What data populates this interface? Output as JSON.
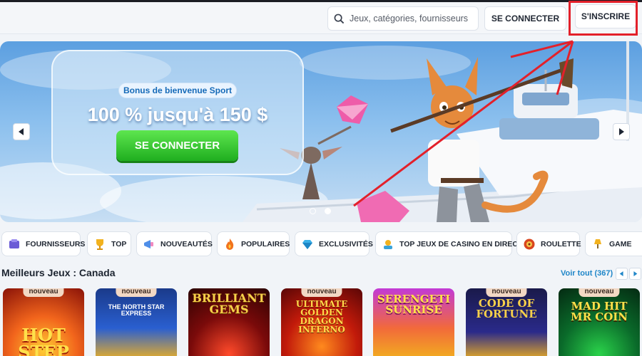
{
  "header": {
    "search_placeholder": "Jeux, catégories, fournisseurs",
    "login_label": "SE CONNECTER",
    "signup_label": "S'INSCRIRE"
  },
  "banner": {
    "badge": "Bonus de bienvenue Sport",
    "headline": "100 % jusqu'à 150 $",
    "cta_label": "SE CONNECTER",
    "slides": 2,
    "active_slide": 2
  },
  "categories": [
    {
      "label": "FOURNISSEURS",
      "icon": "providers-icon"
    },
    {
      "label": "TOP",
      "icon": "trophy-icon"
    },
    {
      "label": "NOUVEAUTÉS",
      "icon": "megaphone-icon"
    },
    {
      "label": "POPULAIRES",
      "icon": "fire-icon"
    },
    {
      "label": "EXCLUSIVITÉS",
      "icon": "diamond-icon"
    },
    {
      "label": "TOP JEUX DE CASINO EN DIRECT",
      "icon": "live-dealer-icon"
    },
    {
      "label": "ROULETTE",
      "icon": "roulette-icon"
    },
    {
      "label": "GAME",
      "icon": "lamp-icon"
    }
  ],
  "section": {
    "title": "Meilleurs Jeux : Canada",
    "see_all": "Voir tout (367)"
  },
  "games": [
    {
      "title": "HOT STEP",
      "badge": "nouveau"
    },
    {
      "title": "THE NORTH STAR EXPRESS",
      "badge": "nouveau"
    },
    {
      "title": "BRILLIANT GEMS",
      "badge": ""
    },
    {
      "title": "ULTIMATE GOLDEN DRAGON INFERNO",
      "badge": "nouveau"
    },
    {
      "title": "SERENGETI SUNRISE",
      "badge": ""
    },
    {
      "title": "CODE OF FORTUNE",
      "badge": "nouveau"
    },
    {
      "title": "MAD HIT MR COIN",
      "badge": "nouveau"
    }
  ],
  "colors": {
    "accent_blue": "#1f86c8",
    "cta_green": "#2fc12a",
    "annotation_red": "#e3202a"
  }
}
